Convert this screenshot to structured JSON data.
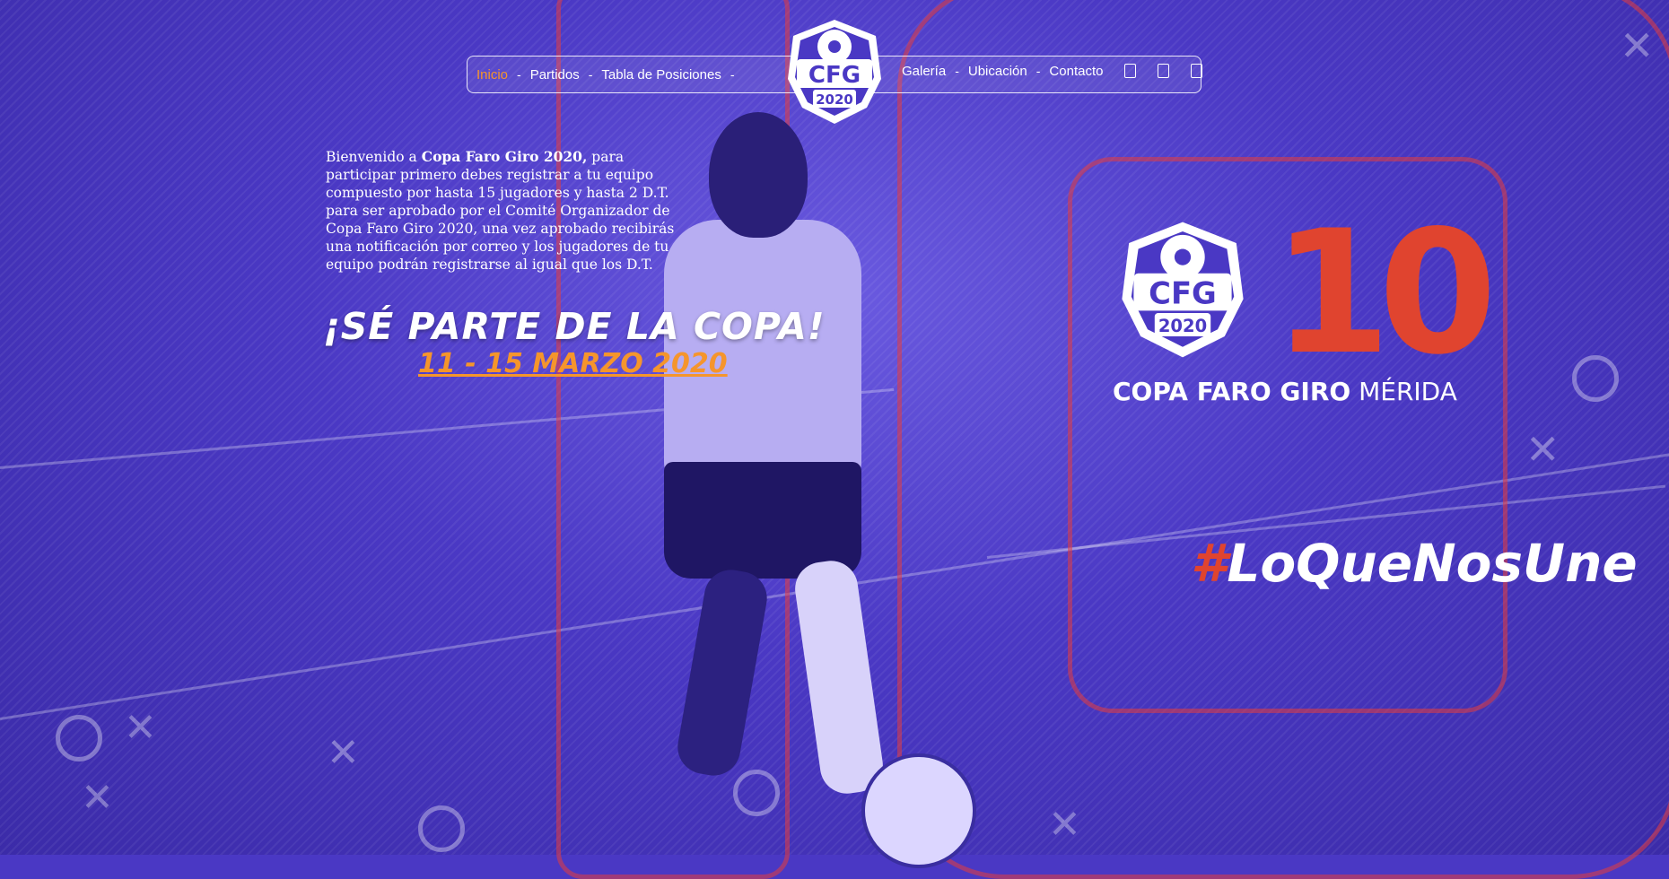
{
  "nav": {
    "left_items": [
      {
        "label": "Inicio",
        "active": true
      },
      {
        "label": "Partidos"
      },
      {
        "label": "Tabla de Posiciones"
      }
    ],
    "right_items": [
      {
        "label": "Galería"
      },
      {
        "label": "Ubicación"
      },
      {
        "label": "Contacto"
      }
    ],
    "separator": "-",
    "social_icons": [
      "social-icon-1",
      "social-icon-2",
      "social-icon-3"
    ]
  },
  "logo": {
    "letters": "CFG",
    "year": "2020"
  },
  "intro": {
    "prefix": "Bienvenido a ",
    "bold": "Copa Faro Giro 2020,",
    "body": " para participar primero debes registrar a tu equipo compuesto por hasta 15 jugadores y hasta 2 D.T. para ser aprobado por el Comité Organizador de Copa Faro Giro 2020, una vez aprobado recibirás una notificación por correo y los jugadores de tu equipo podrán registrarse al igual que los D.T."
  },
  "cta": "¡SÉ PARTE DE LA COPA!",
  "dates": "11 - 15 MARZO 2020",
  "brand": {
    "ten": "10",
    "name_bold": "COPA FARO GIRO",
    "name_light": " MÉRIDA",
    "hash": "#",
    "hashtag": "LoQueNosUne"
  },
  "colors": {
    "accent_orange": "#f5952c",
    "accent_red": "#e0442f",
    "overlay_purple": "#4a38c4"
  }
}
